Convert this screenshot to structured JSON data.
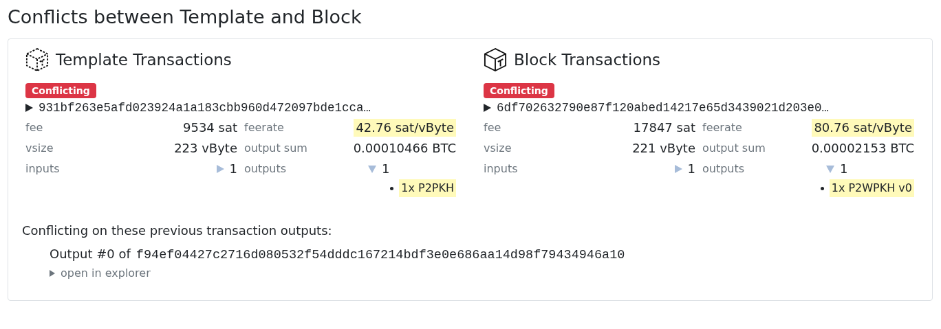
{
  "title": "Conflicts between Template and Block",
  "sides": [
    {
      "kind": "template",
      "heading": "Template Transactions",
      "badge": "Conflicting",
      "txid": "931bf263e5afd023924a1a183cbb960d472097bde1cca…",
      "txid_expanded": false,
      "fee": "9534 sat",
      "feerate_label": "feerate",
      "feerate": "42.76 sat/vByte",
      "feerate_highlighted": true,
      "fee_label": "fee",
      "vsize_label": "vsize",
      "vsize": "223 vByte",
      "output_sum_label": "output sum",
      "output_sum": "0.00010466 BTC",
      "inputs_label": "inputs",
      "inputs": "1",
      "inputs_expanded": false,
      "outputs_label": "outputs",
      "outputs": "1",
      "outputs_expanded": true,
      "output_types": [
        {
          "text": "1x P2PKH",
          "highlighted": true
        }
      ]
    },
    {
      "kind": "block",
      "heading": "Block Transactions",
      "badge": "Conflicting",
      "txid": "6df702632790e87f120abed14217e65d3439021d203e0…",
      "txid_expanded": false,
      "fee": "17847 sat",
      "feerate_label": "feerate",
      "feerate": "80.76 sat/vByte",
      "feerate_highlighted": true,
      "fee_label": "fee",
      "vsize_label": "vsize",
      "vsize": "221 vByte",
      "output_sum_label": "output sum",
      "output_sum": "0.00002153 BTC",
      "inputs_label": "inputs",
      "inputs": "1",
      "inputs_expanded": false,
      "outputs_label": "outputs",
      "outputs": "1",
      "outputs_expanded": true,
      "output_types": [
        {
          "text": "1x P2WPKH v0",
          "highlighted": true
        }
      ]
    }
  ],
  "conflicts": {
    "intro": "Conflicting on these previous transaction outputs:",
    "items": [
      {
        "prefix": "Output #0 of",
        "txid": "f94ef04427c2716d080532f54dddc167214bdf3e0e686aa14d98f79434946a10",
        "link": "open in explorer",
        "expanded": false
      }
    ]
  }
}
